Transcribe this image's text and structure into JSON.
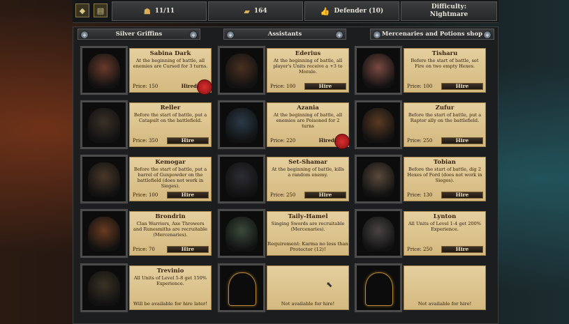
{
  "topbar": {
    "units": "11/11",
    "gold": "164",
    "rank": "Defender (10)",
    "difficulty_label": "Difficulty:",
    "difficulty_value": "Nightmare"
  },
  "columns": [
    "Silver Griffins",
    "Assistants",
    "Mercenaries and Potions shop"
  ],
  "hire_label": "Hire",
  "hired_label": "Hired!",
  "cards": [
    {
      "name": "Sabina Dark",
      "desc": "At the beginning of battle, all enemies are Cursed for 3 turns.",
      "price": "Price: 150",
      "state": "hired"
    },
    {
      "name": "Ederius",
      "desc": "At the beginning of battle, all player's Units receive a +3 to Morale.",
      "price": "Price: 100",
      "state": "hire"
    },
    {
      "name": "Tisharu",
      "desc": "Before the start of battle, set Fire on two empty Hexes.",
      "price": "Price: 100",
      "state": "hire"
    },
    {
      "name": "Reller",
      "desc": "Before the start of battle, put a Catapult on the battlefield.",
      "price": "Price: 350",
      "state": "hire"
    },
    {
      "name": "Azania",
      "desc": "At the beginning of battle, all enemies are Poisoned for 2 turns",
      "price": "Price: 220",
      "state": "hired"
    },
    {
      "name": "Zufur",
      "desc": "Before the start of battle, put a Raptor ally on the battlefield.",
      "price": "Price: 250",
      "state": "hire"
    },
    {
      "name": "Kemogar",
      "desc": "Before the start of battle, put a barrel of Gunpowder on the battlefield (does not work in Sieges).",
      "price": "Price: 100",
      "state": "hire"
    },
    {
      "name": "Set-Shamar",
      "desc": "At the beginning of battle, kills a random enemy.",
      "price": "Price: 250",
      "state": "hire"
    },
    {
      "name": "Tobian",
      "desc": "Before the start of battle, dig 2 Hexes of Ford (does not work in Sieges).",
      "price": "Price: 130",
      "state": "hire"
    },
    {
      "name": "Brondrin",
      "desc": "Clan Warriors, Axe Throwers and Runesmiths are recruitable (Mercenaries).",
      "price": "Price: 70",
      "state": "hire"
    },
    {
      "name": "Taily-Hamel",
      "desc": "Singing Swords are recruitable (Mercenaries).",
      "note": "Requirement: Karma no less than Protector (12)!",
      "state": "locked"
    },
    {
      "name": "Lynton",
      "desc": "All Units of Level 1-4 get 200% Experience.",
      "price": "Price: 250",
      "state": "hire"
    },
    {
      "name": "Trevinio",
      "desc": "All Units of Level 5-8 get 150% Experience.",
      "note": "Will be available for hire later!",
      "state": "later"
    },
    {
      "name": "",
      "desc": "",
      "note": "Not available for hire!",
      "state": "na"
    },
    {
      "name": "",
      "desc": "",
      "note": "Not available for hire!",
      "state": "na"
    }
  ],
  "colors": {
    "parchment": "#dcc48d",
    "seal": "#c02020",
    "panel": "#1c1d1f"
  }
}
